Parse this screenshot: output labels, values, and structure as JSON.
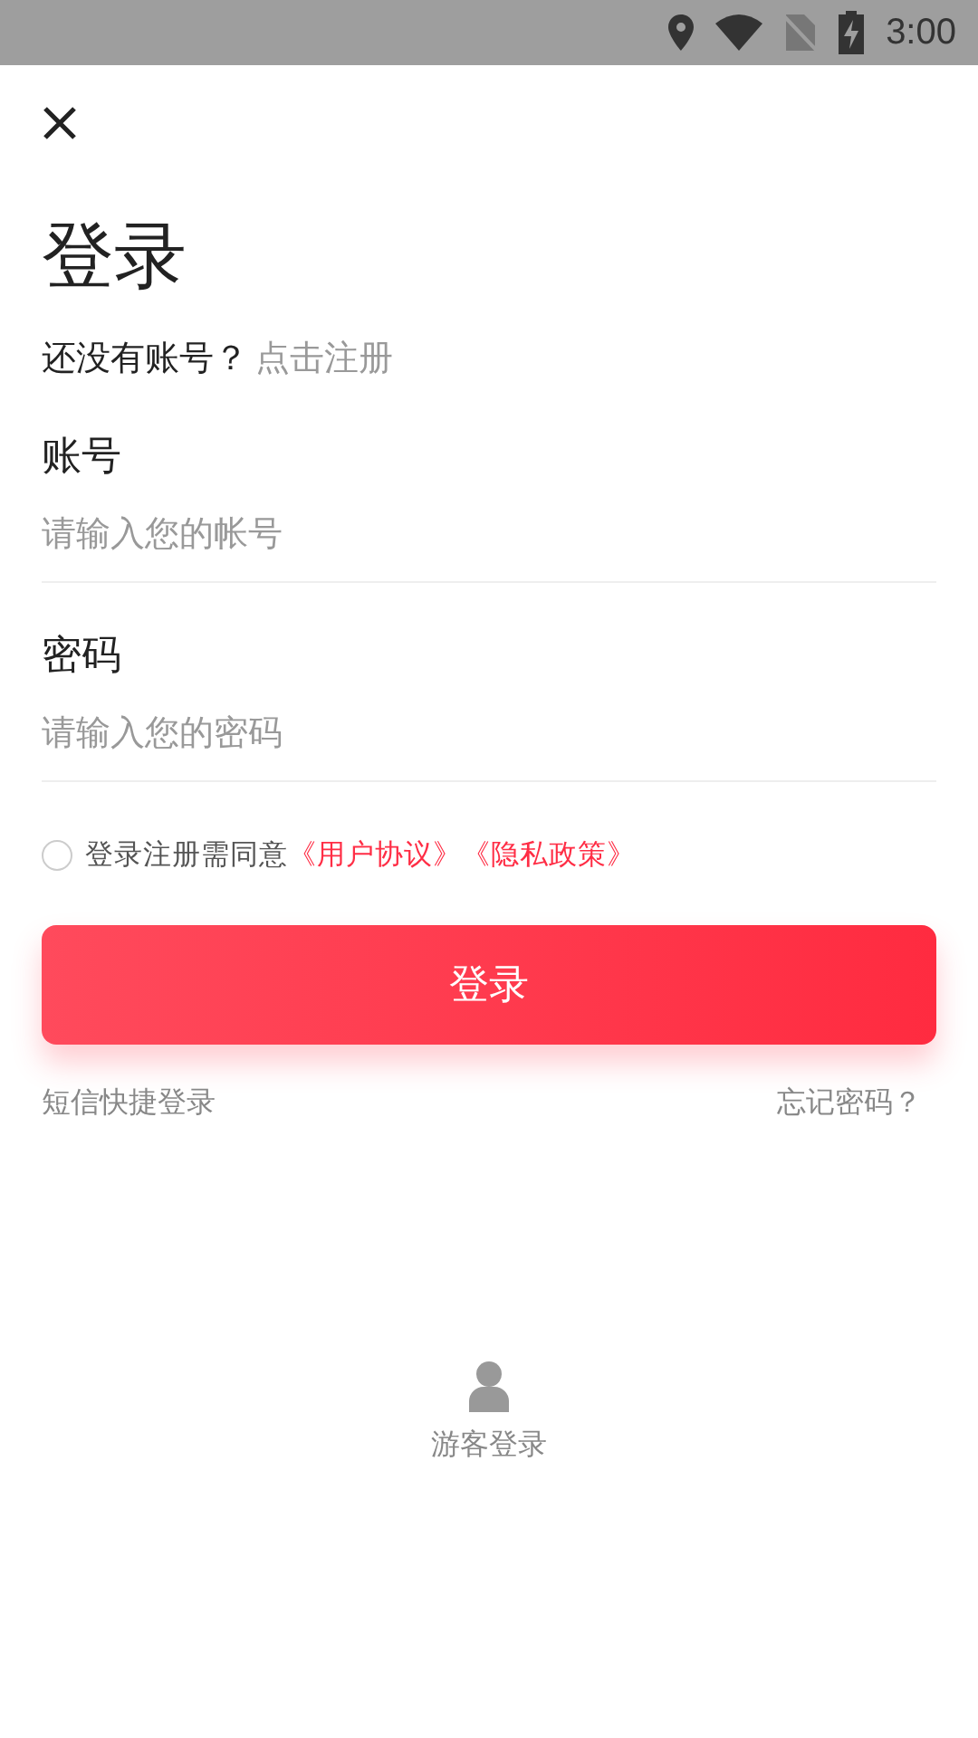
{
  "status_bar": {
    "time": "3:00"
  },
  "title": "登录",
  "register_prompt": {
    "text": "还没有账号？",
    "link": "点击注册"
  },
  "fields": [
    {
      "label": "账号",
      "placeholder": "请输入您的帐号"
    },
    {
      "label": "密码",
      "placeholder": "请输入您的密码"
    }
  ],
  "agreement": {
    "checked": false,
    "text": "登录注册需同意",
    "links": [
      "《用户协议》",
      "《隐私政策》"
    ]
  },
  "login_button": "登录",
  "sms_login": "短信快捷登录",
  "forgot_password": "忘记密码？",
  "guest_login": "游客登录"
}
